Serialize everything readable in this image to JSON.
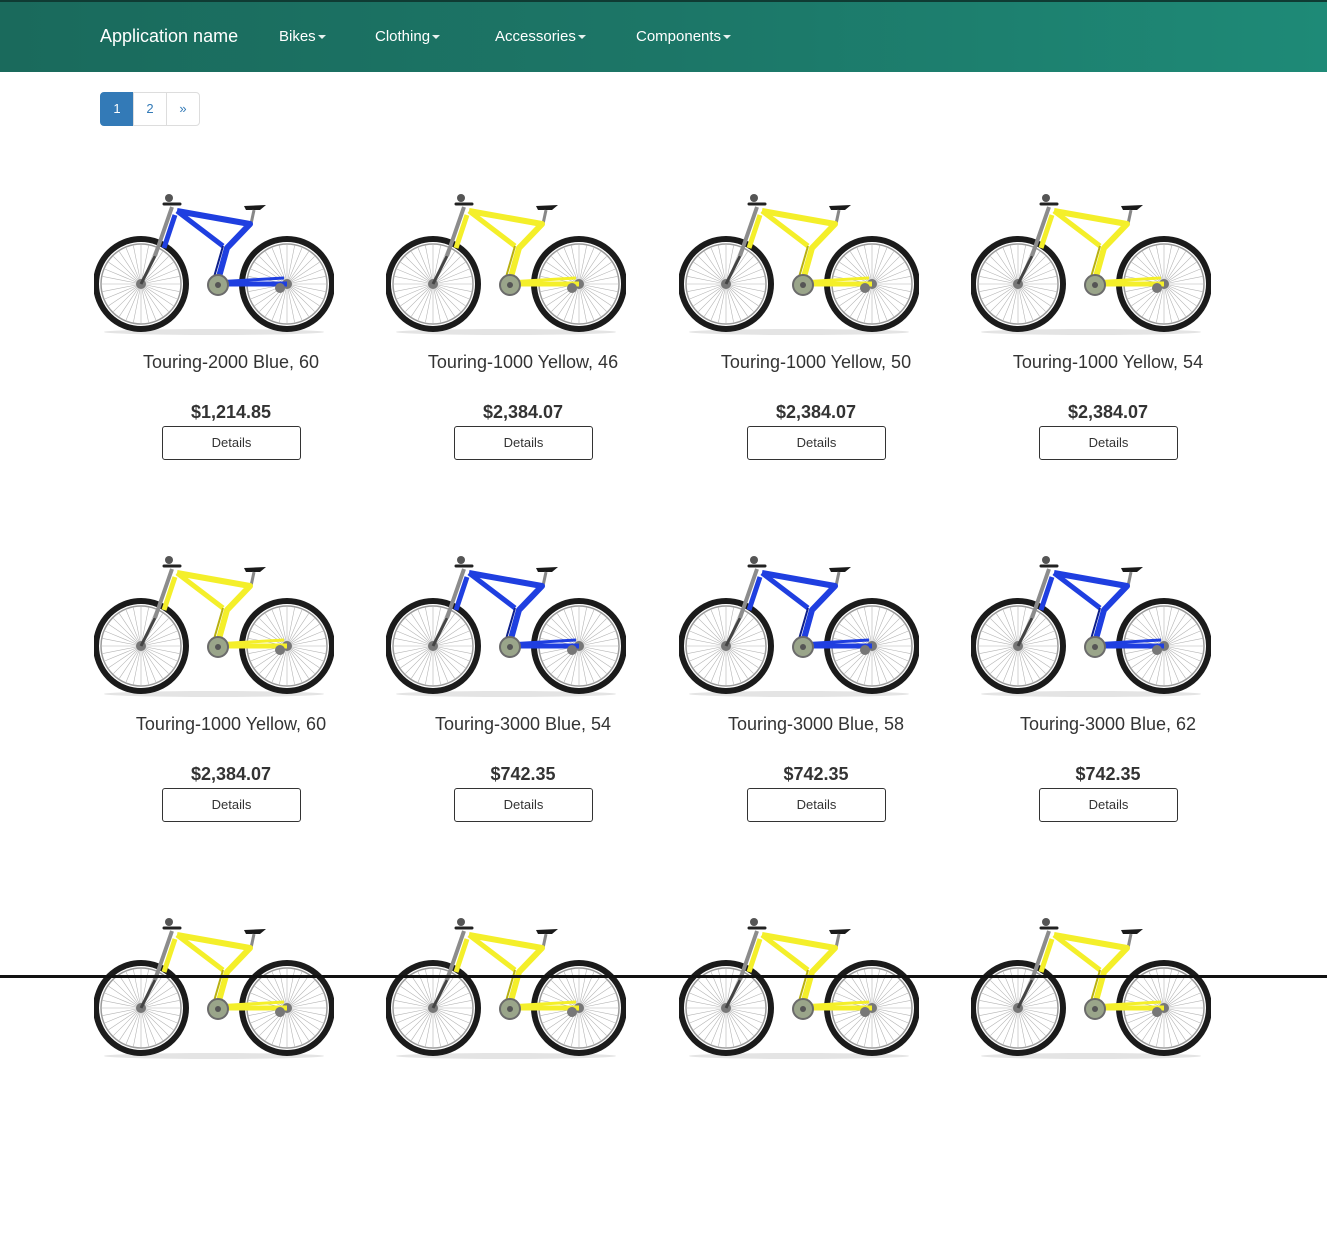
{
  "app": {
    "brand": "Application name"
  },
  "nav": {
    "items": [
      {
        "label": "Bikes"
      },
      {
        "label": "Clothing"
      },
      {
        "label": "Accessories"
      },
      {
        "label": "Components"
      }
    ]
  },
  "pagination": {
    "pages": [
      "1",
      "2",
      "»"
    ],
    "active": "1"
  },
  "products": [
    {
      "name": "Touring-2000 Blue, 60",
      "price": "$1,214.85",
      "button": "Details",
      "color": "blue"
    },
    {
      "name": "Touring-1000 Yellow, 46",
      "price": "$2,384.07",
      "button": "Details",
      "color": "yellow"
    },
    {
      "name": "Touring-1000 Yellow, 50",
      "price": "$2,384.07",
      "button": "Details",
      "color": "yellow"
    },
    {
      "name": "Touring-1000 Yellow, 54",
      "price": "$2,384.07",
      "button": "Details",
      "color": "yellow"
    },
    {
      "name": "Touring-1000 Yellow, 60",
      "price": "$2,384.07",
      "button": "Details",
      "color": "yellow"
    },
    {
      "name": "Touring-3000 Blue, 54",
      "price": "$742.35",
      "button": "Details",
      "color": "blue"
    },
    {
      "name": "Touring-3000 Blue, 58",
      "price": "$742.35",
      "button": "Details",
      "color": "blue"
    },
    {
      "name": "Touring-3000 Blue, 62",
      "price": "$742.35",
      "button": "Details",
      "color": "blue"
    }
  ],
  "partial_row_colors": [
    "yellow",
    "yellow",
    "yellow",
    "yellow"
  ],
  "colors": {
    "navbar": "#1c7667",
    "accent": "#337ab7",
    "bike_blue": "#1f3fe0",
    "bike_yellow": "#f4ef2a"
  }
}
